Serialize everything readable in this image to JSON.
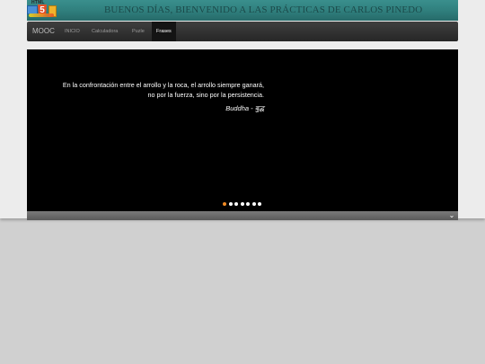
{
  "header": {
    "logo_text": "HTML",
    "logo_number": "5",
    "title": "BUENOS DÍAS, BIENVENIDO A LAS PRÁCTICAS DE CARLOS PINEDO"
  },
  "navbar": {
    "brand": "MOOC",
    "items": [
      {
        "label": "INICIO",
        "active": false
      },
      {
        "label": "Calculadora",
        "active": false
      },
      {
        "label": "Puzle",
        "active": false
      },
      {
        "label": "Frases",
        "active": true
      }
    ]
  },
  "carousel": {
    "quote_line1": "En la confrontación entre el arrollo y la roca, el arrollo siempre ganará,",
    "quote_line2": "no por la fuerza, sino por la persistencia.",
    "author": "Buddha - बुद्ध",
    "slide_count": 7,
    "active_index": 0,
    "colors": {
      "active_dot": "#f08a24",
      "dot": "#ffffff",
      "background": "#000000"
    }
  },
  "footer": {
    "toggle_icon": "chevron-down-icon"
  },
  "colors": {
    "header_accent": "#2f7e7c",
    "title_text": "#1b4a4a",
    "navbar_bg": "#2e2e2e",
    "page_bg": "#d0d0d0"
  }
}
